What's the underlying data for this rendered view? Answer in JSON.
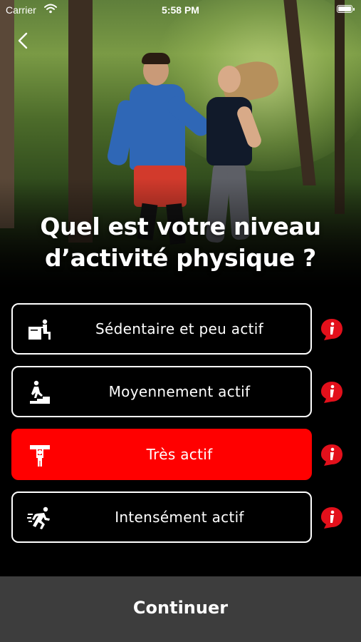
{
  "status_bar": {
    "carrier": "Carrier",
    "time": "5:58 PM"
  },
  "question": {
    "line1": "Quel est votre niveau",
    "line2": "d’activité physique ?"
  },
  "options": [
    {
      "label": "Sédentaire et peu actif",
      "icon": "desk-sitting-icon",
      "selected": false
    },
    {
      "label": "Moyennement actif",
      "icon": "stairs-walking-icon",
      "selected": false
    },
    {
      "label": "Très actif",
      "icon": "carrying-load-icon",
      "selected": true
    },
    {
      "label": "Intensément actif",
      "icon": "sprinting-icon",
      "selected": false
    }
  ],
  "info_icon": "info-icon",
  "continue_label": "Continuer",
  "colors": {
    "accent": "#ff0000",
    "background": "#000000",
    "continue_bar": "#3d3d3d",
    "text": "#ffffff"
  }
}
